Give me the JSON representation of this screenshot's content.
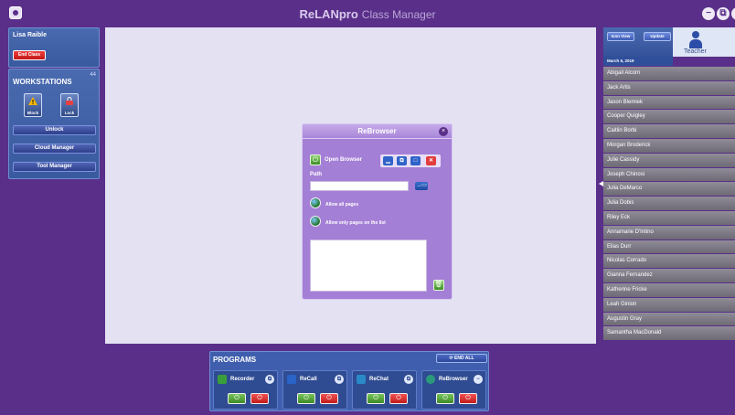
{
  "app": {
    "title_brand": "ReLANpro",
    "title_sub": "Class Manager"
  },
  "left_panel": {
    "user_name": "Lisa Raible",
    "end_class_label": "End Class",
    "workstations_title": "WORKSTATIONS",
    "workstations_count": "44",
    "block_label": "Block",
    "lock_label": "Lock",
    "unlock_label": "Unlock",
    "cloud_manager_label": "Cloud Manager",
    "tool_manager_label": "Tool Manager"
  },
  "rebrowser": {
    "title": "ReBrowser",
    "open_browser_label": "Open Browser",
    "path_label": "Path",
    "path_value": "",
    "allow_all_label": "Allow all pages",
    "allow_list_label": "Allow only pages on the list"
  },
  "right_panel": {
    "icon_view_label": "Icon View",
    "update_label": "Update",
    "teacher_label": "Teacher",
    "date": "March 6, 2019",
    "students": [
      "Abigail Alcorn",
      "Jack Artis",
      "Jason Blemiek",
      "Cooper Quigley",
      "Caitlin Borbi",
      "Morgan Broderick",
      "Julie Cassidy",
      "Joseph Chinosi",
      "Julia DeMarco",
      "Julia Dobis",
      "Riley Eck",
      "Annamarie D'Intino",
      "Elias Durr",
      "Nicolas Corrado",
      "Gianna Fernandez",
      "Katherine Fricke",
      "Leah Ginion",
      "Augustin Gray",
      "Samantha MacDonald"
    ]
  },
  "programs": {
    "title": "PROGRAMS",
    "end_all_label": "END ALL",
    "items": [
      {
        "name": "Recorder",
        "icon": "recorder-icon",
        "toggle": "⧉"
      },
      {
        "name": "ReCall",
        "icon": "recall-icon",
        "toggle": "⧉"
      },
      {
        "name": "ReChat",
        "icon": "rechat-icon",
        "toggle": "⧉"
      },
      {
        "name": "ReBrowser",
        "icon": "rebrowser-icon",
        "toggle": "−"
      }
    ]
  },
  "colors": {
    "background": "#5a2f8a",
    "canvas": "#e4e2f2",
    "panel_blue": "#3f5fae",
    "dialog_purple": "#a47fd6",
    "start_green": "#3d8a24",
    "stop_red": "#c21b1b"
  }
}
